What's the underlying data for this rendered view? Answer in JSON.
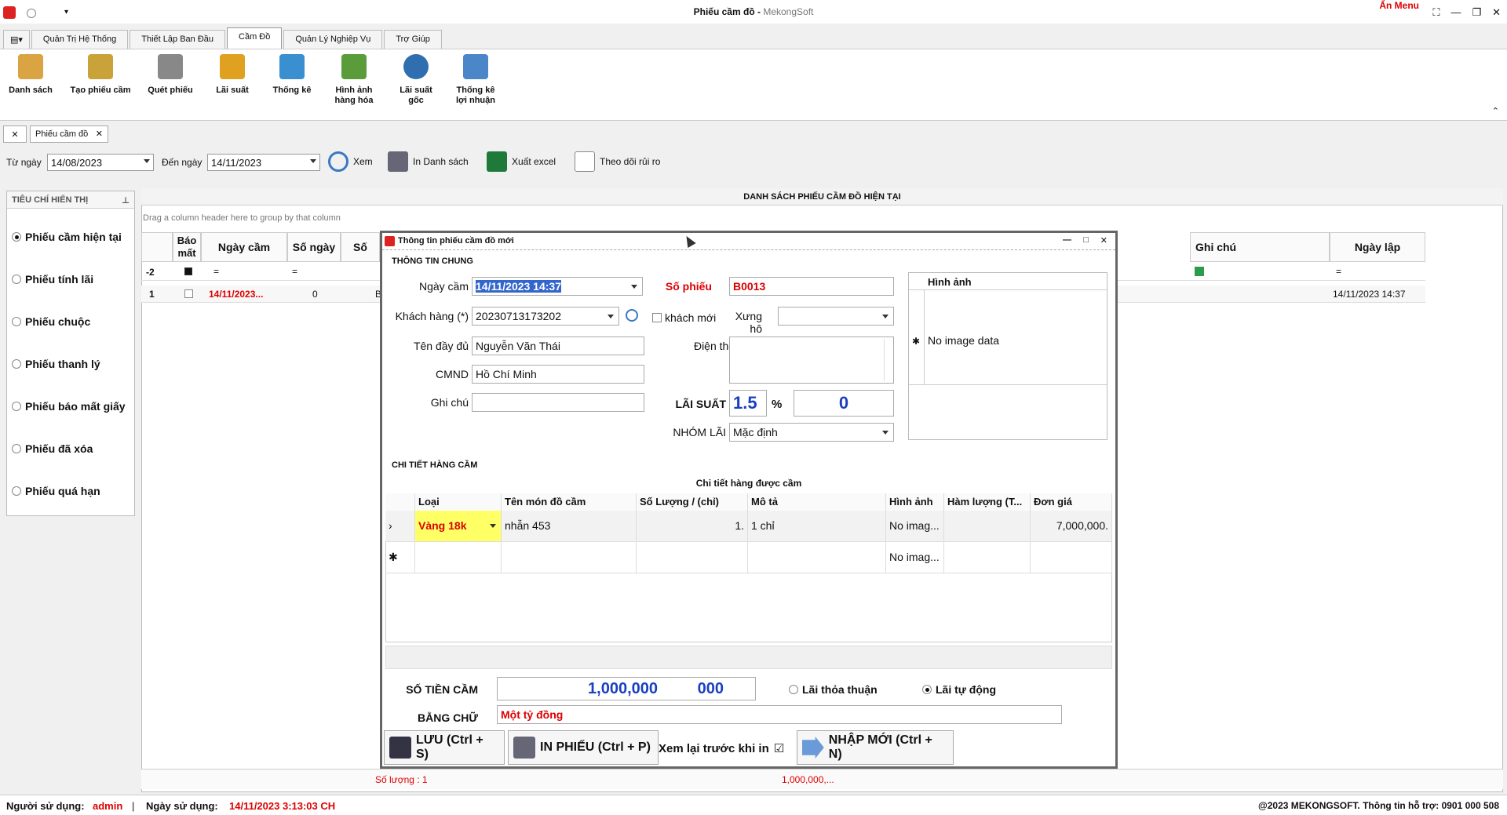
{
  "window": {
    "title": "Phiếu cầm đồ",
    "subtitle": "MekongSoft",
    "an_menu": "Ẩn Menu"
  },
  "ribbon_tabs": [
    "Quản Trị Hệ Thống",
    "Thiết Lập Ban Đầu",
    "Cầm Đồ",
    "Quản Lý Nghiệp Vụ",
    "Trợ Giúp"
  ],
  "ribbon_buttons": [
    {
      "label1": "Danh sách",
      "label2": "",
      "icon": "clipboard-icon",
      "color": "#d9a441"
    },
    {
      "label1": "Tạo phiếu cầm",
      "label2": "",
      "icon": "edit-document-icon",
      "color": "#c9a23a"
    },
    {
      "label1": "Quét phiếu",
      "label2": "",
      "icon": "scanner-icon",
      "color": "#888888"
    },
    {
      "label1": "Lãi suất",
      "label2": "",
      "icon": "percent-icon",
      "color": "#e0a020"
    },
    {
      "label1": "Thống kê",
      "label2": "",
      "icon": "chart-icon",
      "color": "#3a8fd0"
    },
    {
      "label1": "Hình ảnh",
      "label2": "hàng hóa",
      "icon": "picture-icon",
      "color": "#5a9c3a"
    },
    {
      "label1": "Lãi suất",
      "label2": "gốc",
      "icon": "gauge-icon",
      "color": "#2f6fb0"
    },
    {
      "label1": "Thống kê",
      "label2": "lợi nhuận",
      "icon": "report-icon",
      "color": "#4a86c8"
    }
  ],
  "doc_tab": "Phiếu cầm đồ",
  "filter": {
    "from_label": "Từ ngày",
    "from_value": "14/08/2023",
    "to_label": "Đến ngày",
    "to_value": "14/11/2023",
    "view": "Xem",
    "print_list": "In Danh sách",
    "export_excel": "Xuất excel",
    "risk": "Theo dõi rủi ro"
  },
  "left_panel": {
    "header": "TIÊU CHÍ HIỂN THỊ",
    "options": [
      "Phiếu cầm hiện tại",
      "Phiếu tính lãi",
      "Phiếu chuộc",
      "Phiếu thanh lý",
      "Phiếu báo mất giấy",
      "Phiếu đã xóa",
      "Phiếu quá hạn"
    ]
  },
  "grid": {
    "caption": "DANH SÁCH PHIẾU CẦM ĐỒ HIỆN TẠI",
    "group_hint": "Drag a column header here to group by that column",
    "col_bao_mat_1": "Báo",
    "col_bao_mat_2": "mất",
    "col_ngay_cam": "Ngày cầm",
    "col_so_ngay": "Số ngày",
    "col_so_partial": "Số",
    "col_ghi_chu": "Ghi chú",
    "col_ngay_lap": "Ngày lập",
    "filter_row_label": "-2",
    "filter_eq": "=",
    "row1_index": "1",
    "row1_ngay_cam": "14/11/2023...",
    "row1_so_ngay": "0",
    "row1_so": "B",
    "row1_ngay_lap": "14/11/2023 14:37",
    "footer_count": "Số lượng : 1",
    "footer_sum": "1,000,000,..."
  },
  "modal": {
    "title": "Thông tin phiếu cầm đồ mới",
    "section_general": "THÔNG TIN CHUNG",
    "ngay_cam_label": "Ngày cầm",
    "ngay_cam_value": "14/11/2023 14:37",
    "so_phieu_label": "Số phiếu",
    "so_phieu_value": "B0013",
    "khach_hang_label": "Khách hàng (*)",
    "khach_hang_value": "20230713173202",
    "khach_moi_label": "khách mới",
    "xung_ho_label": "Xưng hô",
    "ten_label": "Tên đầy đủ",
    "ten_value": "Nguyễn Văn Thái",
    "dien_thoai_label": "Điện thoại",
    "cmnd_label": "CMND",
    "cmnd_value": "Hồ Chí Minh",
    "ghi_chu_label": "Ghi chú",
    "lai_suat_label": "LÃI SUẤT",
    "lai_suat_value": "1.5",
    "percent": "%",
    "lai_value2": "0",
    "nhom_lai_label": "NHÓM LÃI",
    "nhom_lai_value": "Mặc định",
    "hinh_anh_header": "Hình ảnh",
    "no_image": "No image data",
    "section_detail": "CHI TIẾT HÀNG CẦM",
    "detail_caption": "Chi tiết hàng được cầm",
    "detail_cols": [
      "Loại",
      "Tên món đồ cầm",
      "Số Lượng / (chỉ)",
      "Mô tả",
      "Hình ảnh",
      "Hàm lượng (T...",
      "Đơn giá"
    ],
    "row1": {
      "loai": "Vàng 18k",
      "ten": "nhẫn 453",
      "so_luong": "1.",
      "mo_ta": "1 chỉ",
      "hinh_anh": "No imag...",
      "ham_luong": "",
      "don_gia": "7,000,000."
    },
    "row2_hinh_anh": "No imag...",
    "so_tien_label": "SỐ TIỀN CẦM",
    "so_tien_value": "1,000,000",
    "so_tien_suffix": "000",
    "lai_thoa_thuan": "Lãi thỏa thuận",
    "lai_tu_dong": "Lãi tự động",
    "bang_chu_label": "BẰNG CHỮ",
    "bang_chu_value": "Một tỷ đồng",
    "btn_save": "LƯU (Ctrl + S)",
    "btn_print": "IN PHIẾU (Ctrl + P)",
    "review_label": "Xem lại trước khi in",
    "btn_new": "NHẬP MỚI (Ctrl + N)"
  },
  "status_bar": {
    "user_label": "Người sử dụng:",
    "user_value": "admin",
    "sep": "|",
    "date_label": "Ngày sử dụng:",
    "date_value": "14/11/2023 3:13:03 CH",
    "copyright": "@2023 MEKONGSOFT. Thông tin hỗ trợ: 0901 000 508"
  }
}
